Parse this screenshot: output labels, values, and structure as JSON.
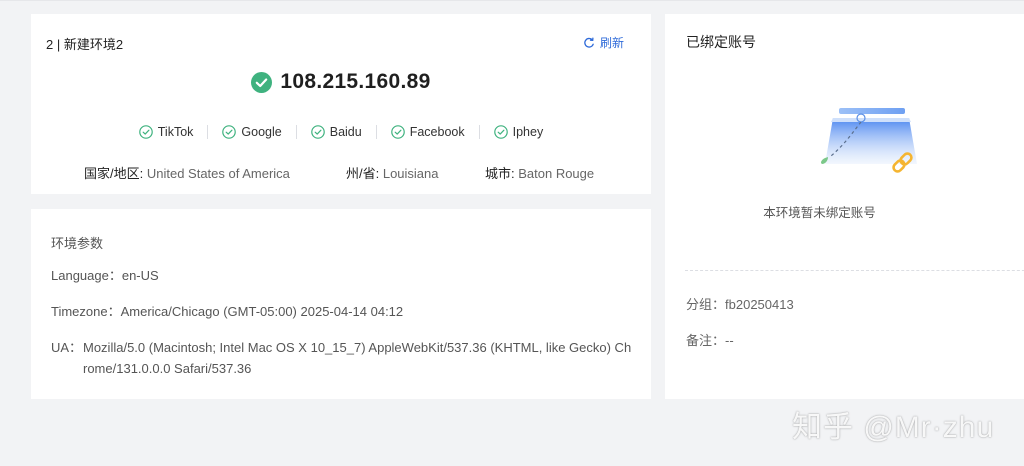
{
  "env": {
    "title": "2 | 新建环境2",
    "refresh_label": "刷新",
    "ip": "108.215.160.89",
    "sites": [
      {
        "label": "TikTok",
        "icon": "check-circle-icon"
      },
      {
        "label": "Google",
        "icon": "check-circle-icon"
      },
      {
        "label": "Baidu",
        "icon": "check-circle-icon"
      },
      {
        "label": "Facebook",
        "icon": "check-circle-icon"
      },
      {
        "label": "Iphey",
        "icon": "check-circle-icon"
      }
    ],
    "country_label": "国家/地区: ",
    "country_value": "United States of America",
    "state_label": "州/省: ",
    "state_value": "Louisiana",
    "city_label": "城市: ",
    "city_value": "Baton Rouge"
  },
  "params": {
    "title": "环境参数",
    "language_label": "Language：",
    "language_value": "en-US",
    "timezone_label": "Timezone：",
    "timezone_value": "America/Chicago (GMT-05:00) 2025-04-14 04:12",
    "ua_label": "UA：",
    "ua_value": "Mozilla/5.0 (Macintosh; Intel Mac OS X 10_15_7) AppleWebKit/537.36 (KHTML, like Gecko) Chrome/131.0.0.0 Safari/537.36"
  },
  "account": {
    "title": "已绑定账号",
    "empty_note": "本环境暂未绑定账号",
    "group_label": "分组：",
    "group_value": "fb20250413",
    "remark_label": "备注：",
    "remark_value": "--"
  },
  "watermark": "知乎 @Mr·zhu",
  "colors": {
    "accent": "#2f6bd9",
    "success": "#3fb27f",
    "page_bg": "#f2f3f5"
  }
}
